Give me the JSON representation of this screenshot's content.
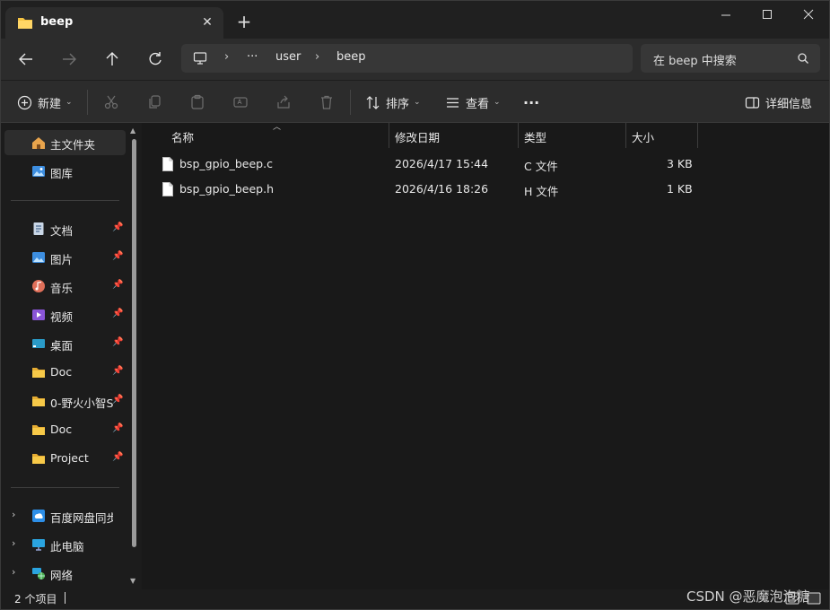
{
  "tab": {
    "title": "beep",
    "close": "✕",
    "new_tab": "+"
  },
  "window_controls": {
    "minimize": "—",
    "maximize": "☐",
    "close": "✕"
  },
  "address": {
    "ellipsis": "···",
    "crumbs": [
      "user",
      "beep"
    ],
    "separator": "›"
  },
  "search": {
    "placeholder": "在 beep 中搜索"
  },
  "commands": {
    "new": "新建",
    "sort": "排序",
    "view": "查看",
    "more": "···",
    "details": "详细信息"
  },
  "sidebar": {
    "top": [
      {
        "label": "主文件夹",
        "icon": "home-icon"
      },
      {
        "label": "图库",
        "icon": "gallery-icon"
      }
    ],
    "pinned": [
      {
        "label": "文档",
        "icon": "documents-icon"
      },
      {
        "label": "图片",
        "icon": "pictures-icon"
      },
      {
        "label": "音乐",
        "icon": "music-icon"
      },
      {
        "label": "视频",
        "icon": "videos-icon"
      },
      {
        "label": "桌面",
        "icon": "desktop-icon"
      },
      {
        "label": "Doc",
        "icon": "folder-icon"
      },
      {
        "label": "0-野火小智S",
        "icon": "folder-icon"
      },
      {
        "label": "Doc",
        "icon": "folder-icon"
      },
      {
        "label": "Project",
        "icon": "folder-icon"
      }
    ],
    "bottom": [
      {
        "label": "百度网盘同步空",
        "icon": "cloud-sync-icon"
      },
      {
        "label": "此电脑",
        "icon": "this-pc-icon"
      },
      {
        "label": "网络",
        "icon": "network-icon"
      }
    ]
  },
  "columns": {
    "name": "名称",
    "modified": "修改日期",
    "type": "类型",
    "size": "大小"
  },
  "files": [
    {
      "name": "bsp_gpio_beep.c",
      "modified": "2026/4/17 15:44",
      "type": "C 文件",
      "size": "3 KB"
    },
    {
      "name": "bsp_gpio_beep.h",
      "modified": "2026/4/16 18:26",
      "type": "H 文件",
      "size": "1 KB"
    }
  ],
  "status": {
    "count": "2 个项目"
  },
  "watermark": "CSDN @恶魔泡泡糖",
  "colors": {
    "folder": "#f5c342",
    "accent": "#4ca0e0"
  }
}
